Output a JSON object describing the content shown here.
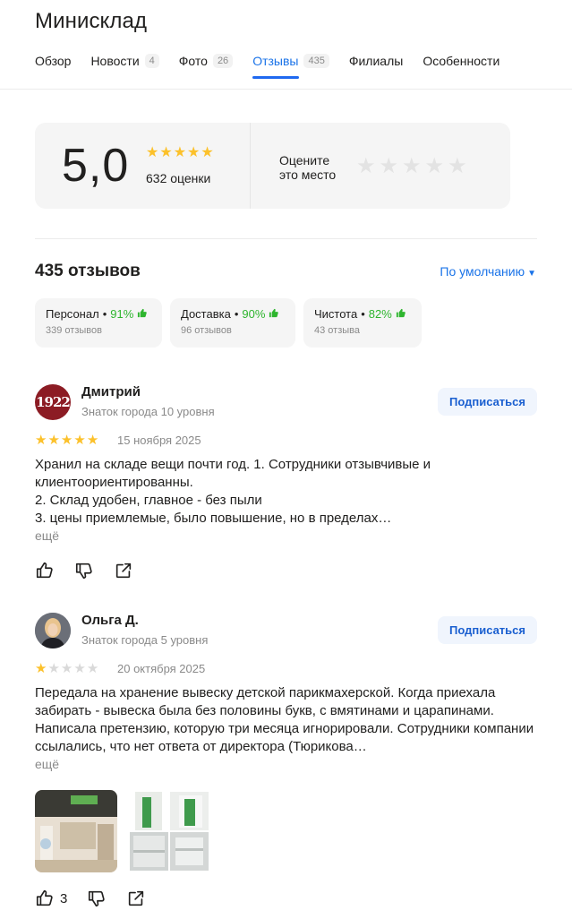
{
  "header": {
    "title": "Минисклад",
    "tabs": [
      {
        "label": "Обзор",
        "count": ""
      },
      {
        "label": "Новости",
        "count": "4"
      },
      {
        "label": "Фото",
        "count": "26"
      },
      {
        "label": "Отзывы",
        "count": "435"
      },
      {
        "label": "Филиалы",
        "count": ""
      },
      {
        "label": "Особенности",
        "count": ""
      }
    ],
    "active_tab": "Отзывы"
  },
  "rating": {
    "score": "5,0",
    "count_label": "632 оценки",
    "stars": 5,
    "rate_prompt": "Оцените это место",
    "star_color": "#fcc12b"
  },
  "reviews_summary": {
    "count_label": "435 отзывов",
    "sort_label": "По умолчанию"
  },
  "aspects": [
    {
      "name": "Персонал",
      "percent": "91%",
      "count": "339 отзывов"
    },
    {
      "name": "Доставка",
      "percent": "90%",
      "count": "96 отзывов"
    },
    {
      "name": "Чистота",
      "percent": "82%",
      "count": "43 отзыва"
    }
  ],
  "reviews": [
    {
      "author": "Дмитрий",
      "level": "Знаток города 10 уровня",
      "avatar_text": "1922",
      "subscribe_label": "Подписаться",
      "rating": 5,
      "date": "15 ноября 2025",
      "text": [
        "Хранил на складе вещи почти год. 1. Сотрудники отзывчивые и клиентоориентированны.",
        "2. Склад удобен, главное - без пыли",
        "3. цены приемлемые, было повышение, но в пределах…"
      ],
      "more_label": "ещё",
      "likes": ""
    },
    {
      "author": "Ольга Д.",
      "level": "Знаток города 5 уровня",
      "subscribe_label": "Подписаться",
      "rating": 1,
      "date": "20 октября 2025",
      "text": [
        "Передала на хранение вывеску детской парикмахерской. Когда приехала забирать - вывеска была без половины букв, с вмятинами и царапинами. Написала претензию, которую три месяца игнорировали. Сотрудники компании ссылались, что нет ответа от директора (Тюрикова…"
      ],
      "more_label": "ещё",
      "likes": "3"
    }
  ],
  "accent_color": "#1a73e8",
  "positive_color": "#2eb52e"
}
